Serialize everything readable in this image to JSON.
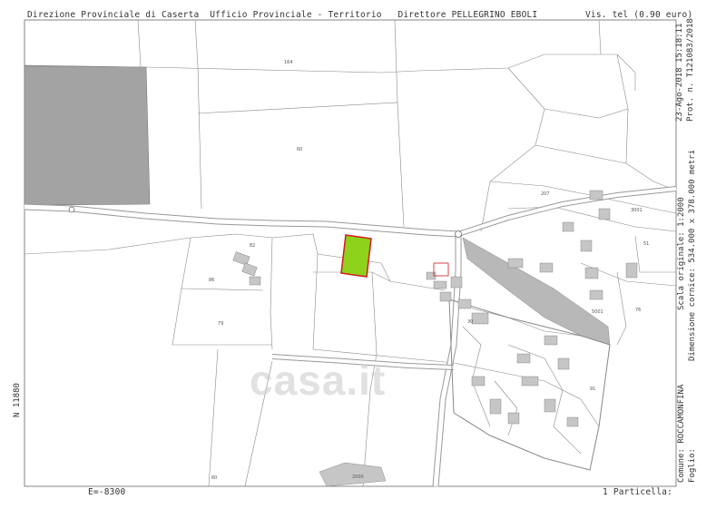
{
  "header": {
    "left_text": "Direzione Provinciale di Caserta  Ufficio Provinciale - Territorio   Direttore PELLEGRINO EBOLI",
    "right_text": "Vis. tel (0.90 euro)"
  },
  "right_margin": {
    "date_line": "23-Ago-2018 15:18:11",
    "prot_line": "Prot. n. T121083/2018",
    "scale_line": "Scala originale: 1:2000",
    "dimension_line": "Dimensione cornice: 534.000 x 378.000 metri",
    "comune_line": "Comune: ROCCAMONFINA",
    "foglio_line": "Foglio:"
  },
  "left_margin": {
    "north_coord": "N 11880"
  },
  "footer": {
    "east_coord": "E=-8300",
    "particella": "1 Particella:"
  },
  "watermark": {
    "text": "casa.it"
  },
  "parcel_labels": [
    "164",
    "60",
    "82",
    "86",
    "79",
    "207",
    "5001",
    "30",
    "91",
    "3001",
    "2000",
    "60",
    "51",
    "76"
  ],
  "colors": {
    "highlight_fill": "#8ed21b",
    "highlight_stroke": "#d11a1a",
    "gray_area": "#a3a3a3",
    "road": "#b8b8b8",
    "line": "#8a8a8a"
  }
}
